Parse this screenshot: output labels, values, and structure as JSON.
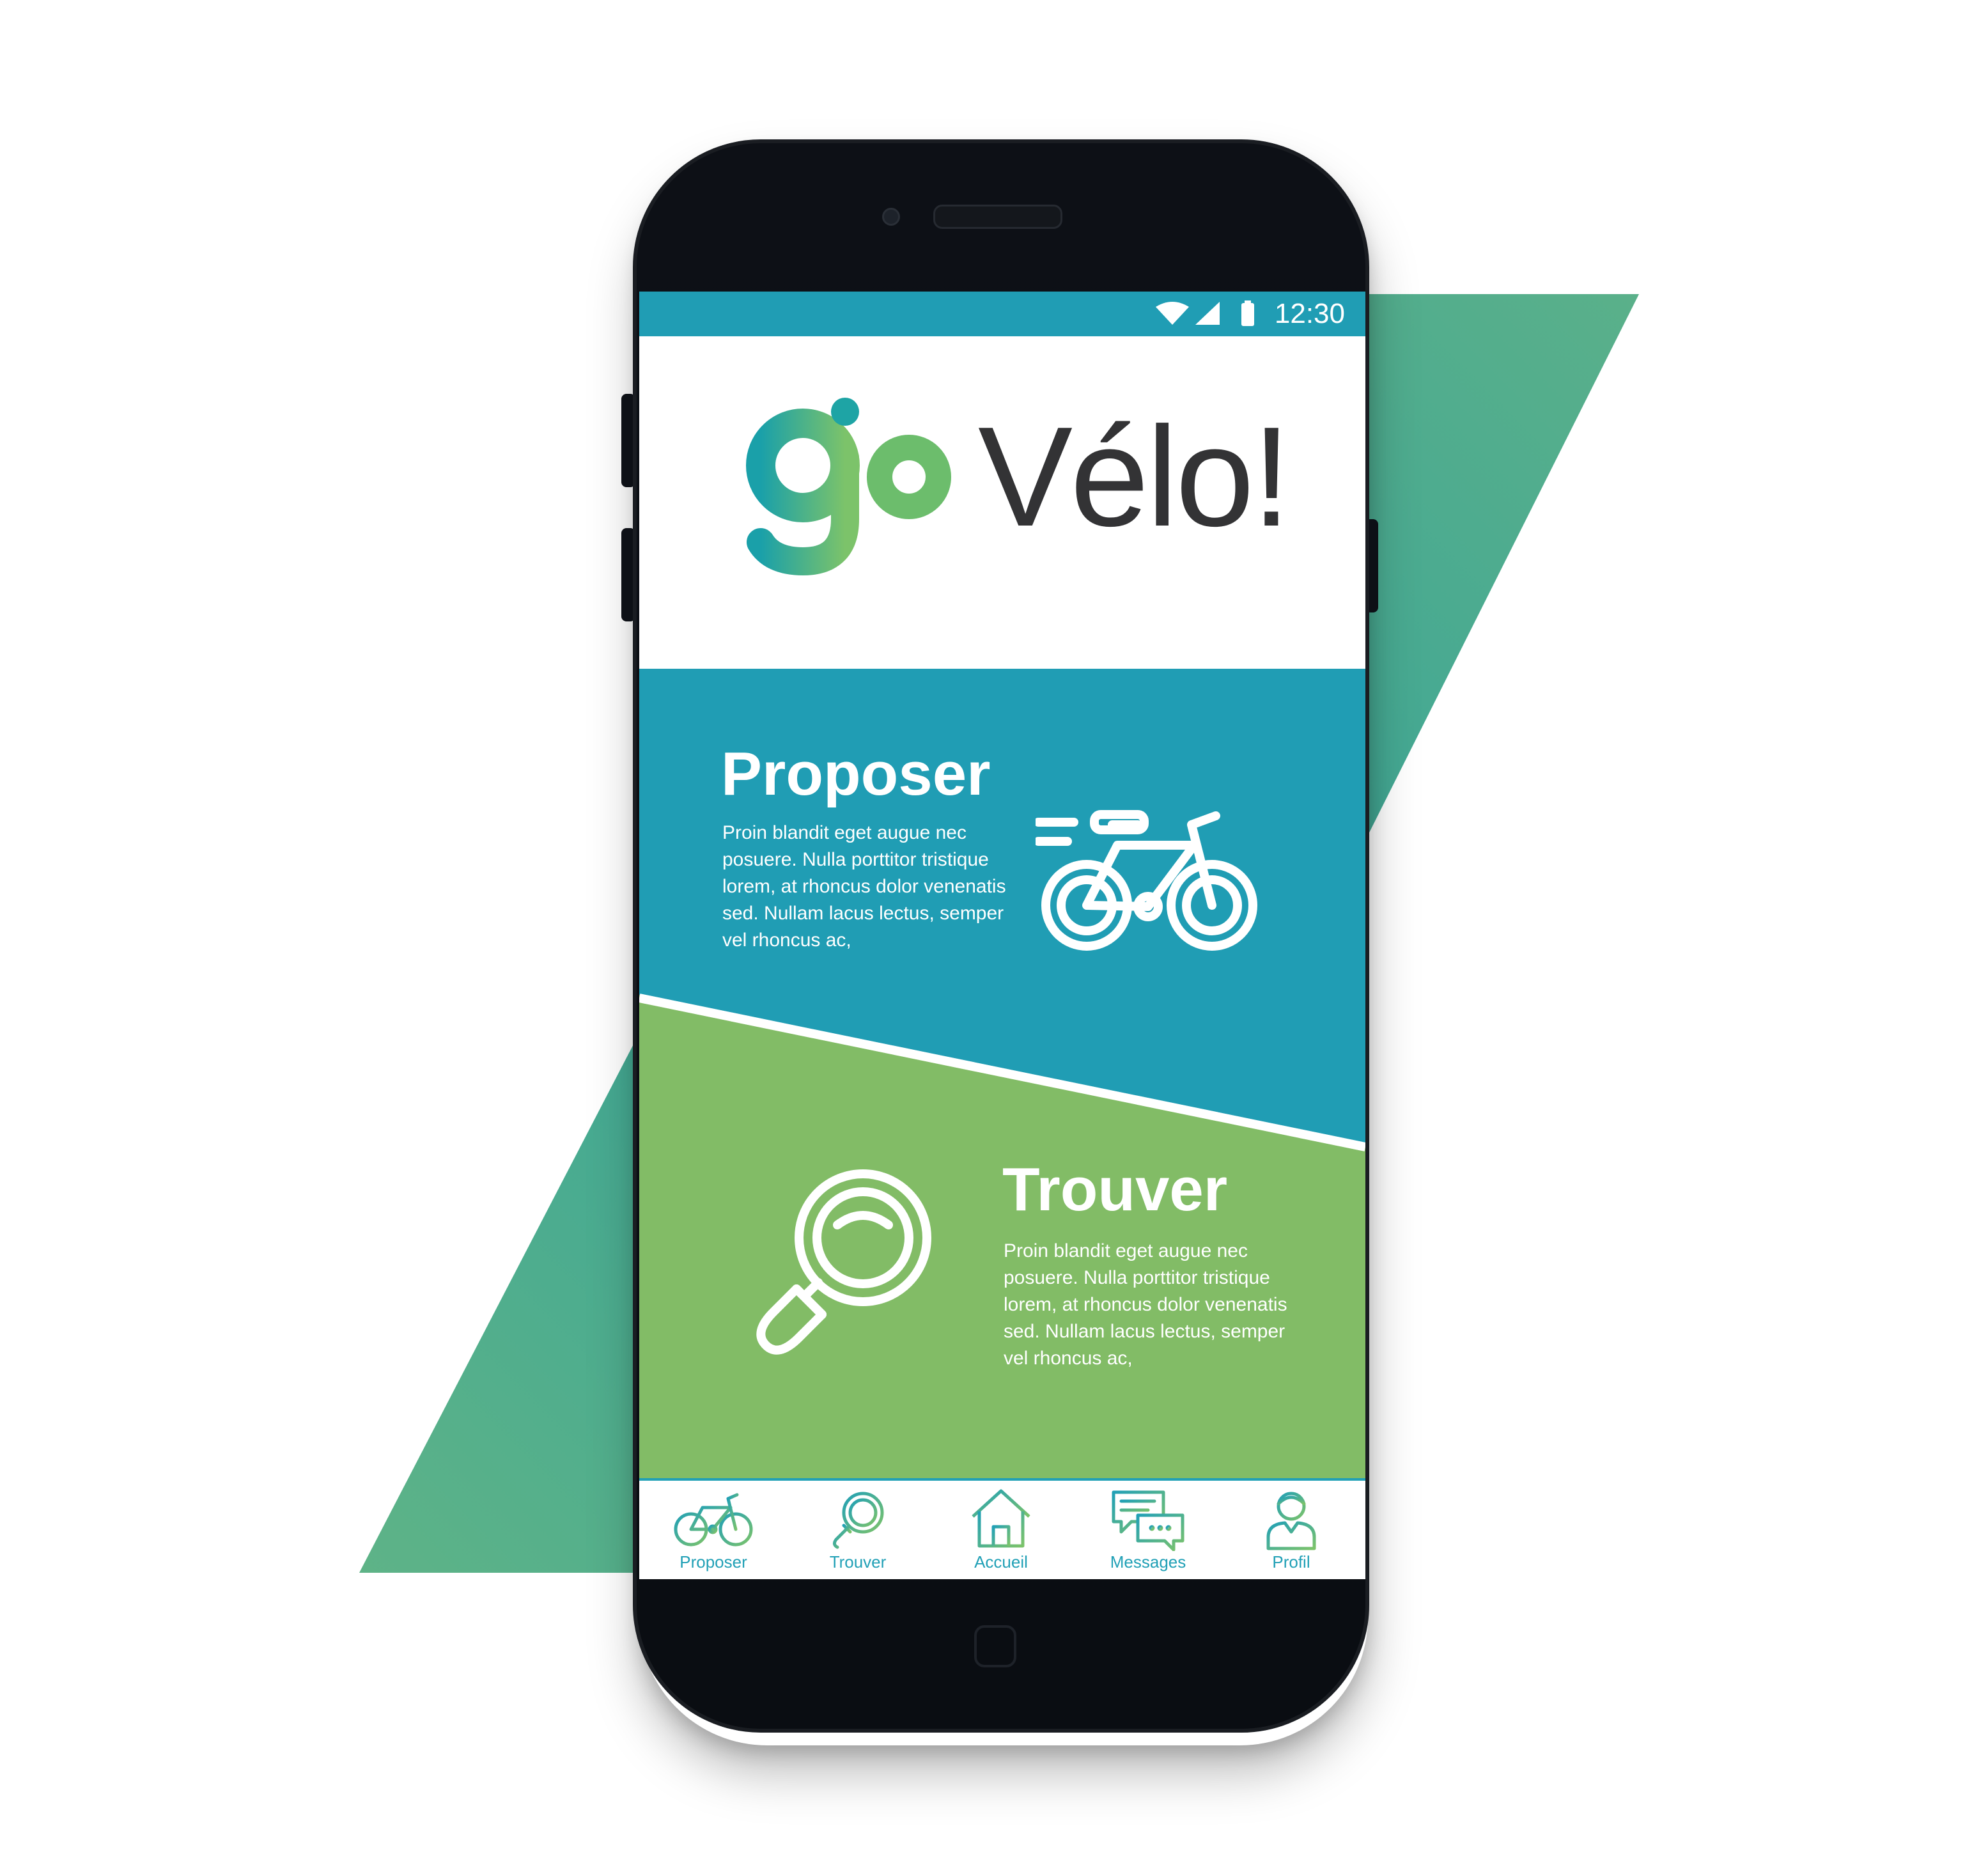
{
  "status_bar": {
    "time": "12:30"
  },
  "logo": {
    "go": "go",
    "velo": "Vélo!"
  },
  "sections": {
    "proposer": {
      "title": "Proposer",
      "text": "Proin blandit eget augue nec posuere. Nulla porttitor tristique lorem, at rhoncus dolor venenatis sed. Nullam lacus lectus, semper vel rhoncus ac,",
      "icon": "bicycle-icon"
    },
    "trouver": {
      "title": "Trouver",
      "text": "Proin blandit eget augue nec posuere. Nulla porttitor tristique lorem, at rhoncus dolor venenatis sed. Nullam lacus lectus, semper vel rhoncus ac,",
      "icon": "magnifier-icon"
    }
  },
  "nav": {
    "items": [
      {
        "label": "Proposer",
        "icon": "bicycle-icon"
      },
      {
        "label": "Trouver",
        "icon": "search-icon"
      },
      {
        "label": "Accueil",
        "icon": "home-icon"
      },
      {
        "label": "Messages",
        "icon": "messages-icon"
      },
      {
        "label": "Profil",
        "icon": "profile-icon"
      }
    ]
  },
  "colors": {
    "teal": "#209db4",
    "green": "#82bc66",
    "logo_gradient_start": "#1aa1a7",
    "logo_gradient_end": "#7cc36a",
    "logo_text": "#333335",
    "background_shape_start": "#2fa198",
    "background_shape_end": "#6bb57e"
  }
}
